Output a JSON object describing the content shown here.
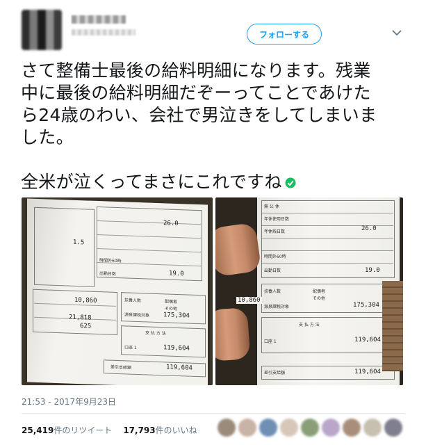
{
  "header": {
    "follow_label": "フォローする"
  },
  "tweet": {
    "lines": [
      "さて整備士最後の給料明細になります。残業",
      "中に最後の給料明細だぞーってことであけた",
      "ら24歳のわい、会社で男泣きをしてしまいま",
      "した。"
    ],
    "last_line": "全米が泣くってまさにこれですね"
  },
  "photos": {
    "left": {
      "values": [
        "26.0",
        "1.5",
        "19.0",
        "10,860",
        "21,818",
        "625",
        "175,304",
        "119,604",
        "119,604"
      ],
      "labels": [
        "扶養人数",
        "配偶者",
        "その他",
        "源泉課税対象",
        "支 払 方 法",
        "口座 1",
        "差引支給額",
        "時間外60時",
        "出勤日数"
      ]
    },
    "right": {
      "values": [
        "26.0",
        "19.0",
        "10,860",
        "175,304",
        "119,604",
        "119,604"
      ],
      "labels": [
        "扶養人数",
        "配偶者",
        "その他",
        "源泉課税対象",
        "支 払 方 法",
        "口座 1",
        "差引支給額",
        "時間外60時",
        "出勤日数",
        "年休使用日数",
        "年休残日数",
        "無 公 休"
      ]
    }
  },
  "meta": {
    "timestamp": "21:53 - 2017年9月23日",
    "retweets_count": "25,419",
    "retweets_label": "件のリツイート",
    "likes_count": "17,793",
    "likes_label": "件のいいね"
  },
  "colors": {
    "accent": "#1da1f2",
    "text": "#14171a",
    "muted": "#657786",
    "verified": "#17bf63"
  }
}
